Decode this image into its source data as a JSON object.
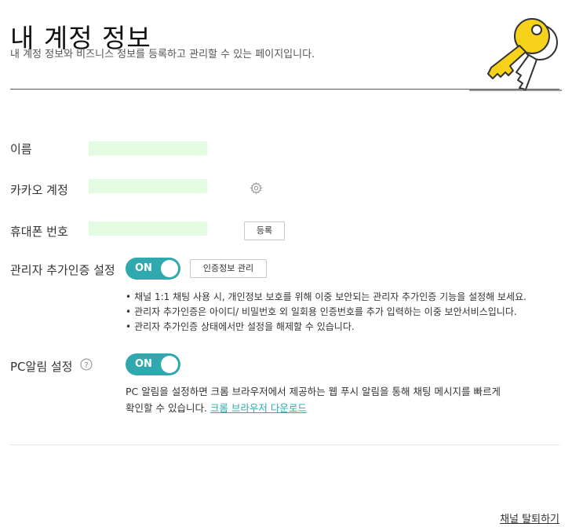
{
  "header": {
    "title": "내 계정 정보",
    "description": "내 계정 정보와 비즈니스 정보를 등록하고 관리할 수 있는 페이지입니다."
  },
  "fields": {
    "name_label": "이름",
    "kakao_account_label": "카카오 계정",
    "phone_label": "휴대폰 번호",
    "phone_register_button": "등록"
  },
  "admin_auth": {
    "label": "관리자 추가인증 설정",
    "toggle_state": "ON",
    "manage_button": "인증정보 관리",
    "notes": [
      "채널 1:1 채팅 사용 시, 개인정보 보호를 위해 이중 보안되는 관리자 추가인증 기능을 설정해 보세요.",
      "관리자 추가인증은 아이디/ 비밀번호 외 일회용 인증번호를 추가 입력하는 이중 보안서비스입니다.",
      "관리자 추가인증 상태에서만 설정을 해제할 수 있습니다."
    ]
  },
  "pc_alert": {
    "label": "PC알림 설정",
    "toggle_state": "ON",
    "description_line1": "PC 알림을 설정하면 크롬 브라우저에서 제공하는 웹 푸시 알림을 통해 채팅 메시지를 빠르게",
    "description_line2": "확인할 수 있습니다.",
    "download_link": "크롬 브라우저 다운로드"
  },
  "footer": {
    "withdraw_link": "채널 탈퇴하기"
  },
  "colors": {
    "accent": "#2fa8ae",
    "value_fill": "#e3fbe0",
    "key_yellow": "#f7d21a"
  }
}
